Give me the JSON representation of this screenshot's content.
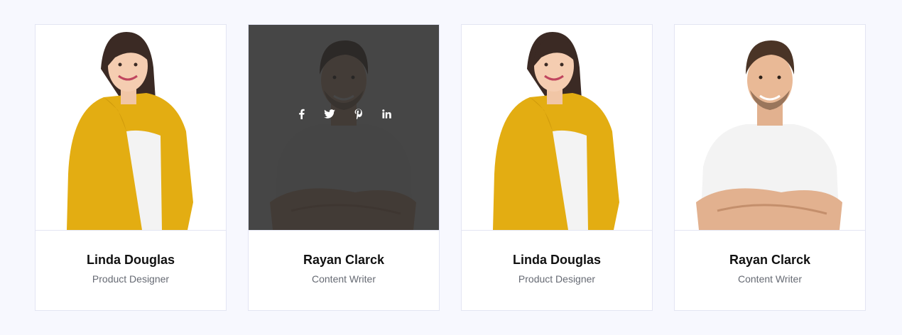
{
  "members": [
    {
      "name": "Linda Douglas",
      "role": "Product Designer"
    },
    {
      "name": "Rayan Clarck",
      "role": "Content Writer"
    },
    {
      "name": "Linda Douglas",
      "role": "Product Designer"
    },
    {
      "name": "Rayan Clarck",
      "role": "Content Writer"
    }
  ],
  "social_icons": [
    "facebook-icon",
    "twitter-icon",
    "pinterest-icon",
    "linkedin-icon"
  ],
  "colors": {
    "background": "#f7f8fe",
    "card_border": "#e3e5f3",
    "overlay": "#3a3a3a",
    "cardigan": "#e3ad12",
    "name_text": "#111111",
    "role_text": "#666a73"
  }
}
